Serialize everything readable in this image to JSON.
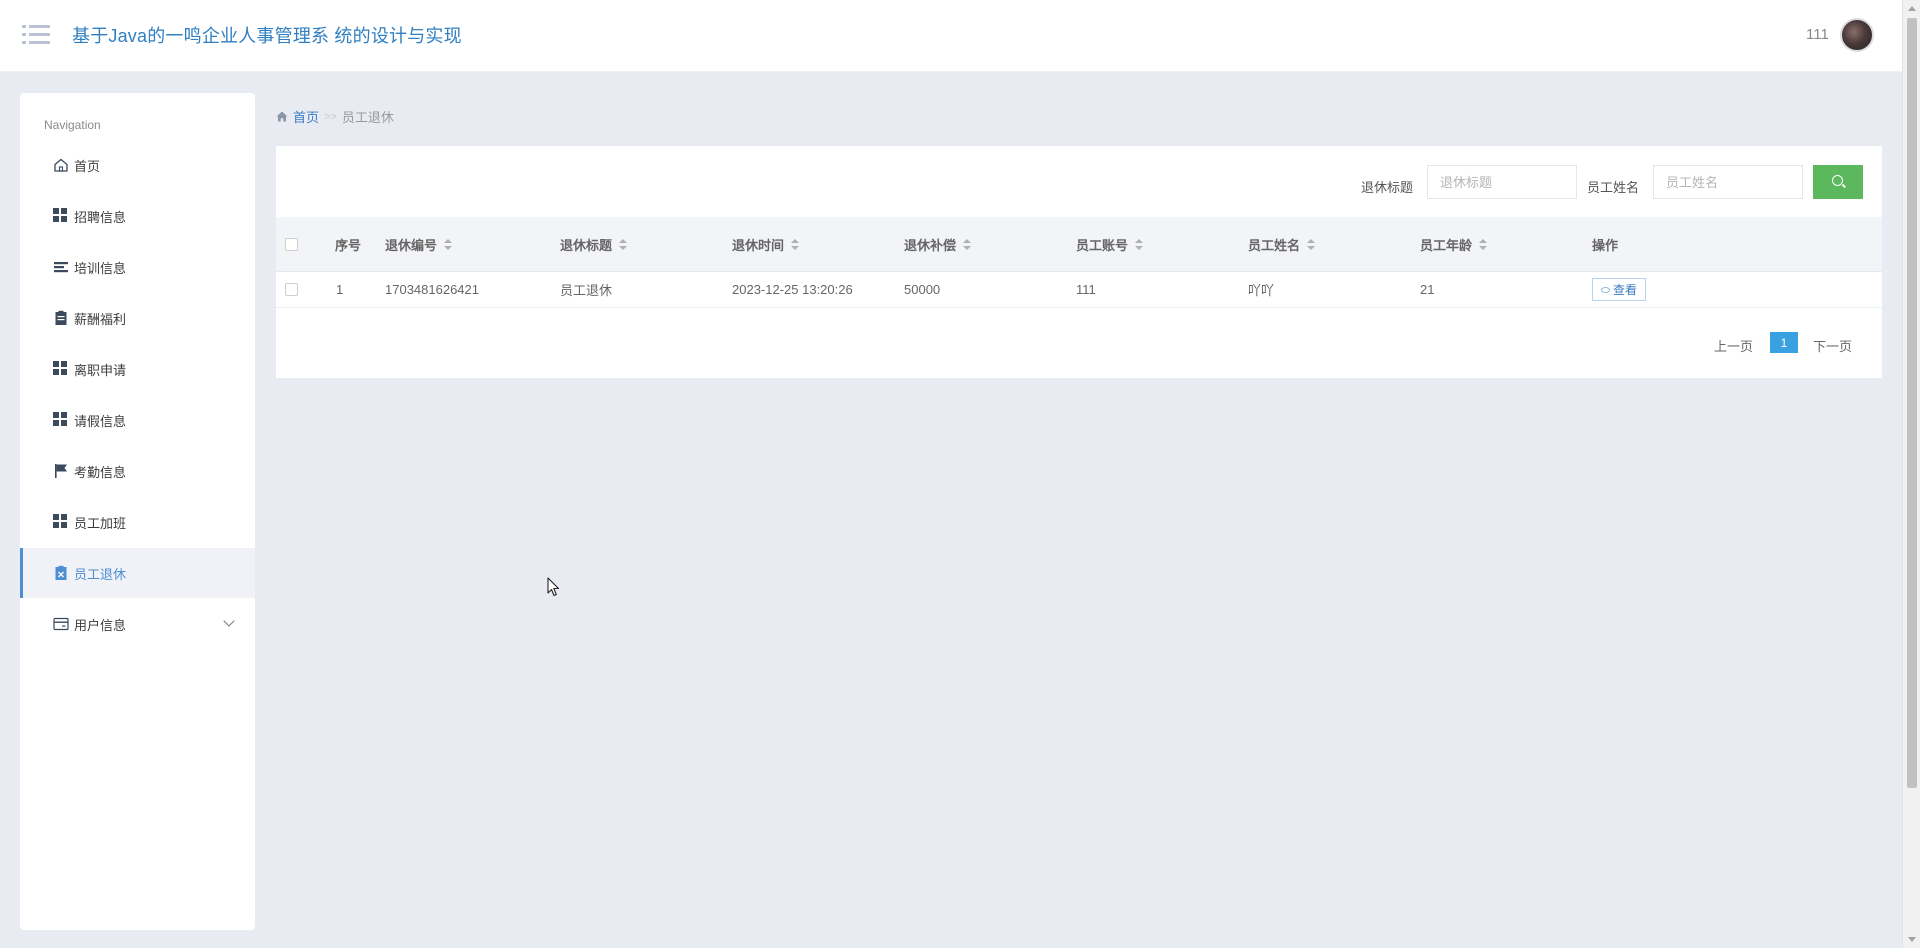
{
  "header": {
    "title": "基于Java的一鸣企业人事管理系 统的设计与实现",
    "user": "111"
  },
  "sidebar": {
    "heading": "Navigation",
    "items": [
      {
        "label": "首页",
        "icon": "home-icon"
      },
      {
        "label": "招聘信息",
        "icon": "grid-icon"
      },
      {
        "label": "培训信息",
        "icon": "list-icon"
      },
      {
        "label": "薪酬福利",
        "icon": "clipboard-icon"
      },
      {
        "label": "离职申请",
        "icon": "grid-icon"
      },
      {
        "label": "请假信息",
        "icon": "grid-icon"
      },
      {
        "label": "考勤信息",
        "icon": "flag-icon"
      },
      {
        "label": "员工加班",
        "icon": "grid-icon"
      },
      {
        "label": "员工退休",
        "icon": "clipboard-x-icon",
        "active": true
      },
      {
        "label": "用户信息",
        "icon": "card-icon",
        "expandable": true
      }
    ]
  },
  "breadcrumb": {
    "home": "首页",
    "separator": ">>",
    "current": "员工退休"
  },
  "search": {
    "title_label": "退休标题",
    "title_placeholder": "退休标题",
    "name_label": "员工姓名",
    "name_placeholder": "员工姓名"
  },
  "table": {
    "columns": [
      "序号",
      "退休编号",
      "退休标题",
      "退休时间",
      "退休补偿",
      "员工账号",
      "员工姓名",
      "员工年龄",
      "操作"
    ],
    "rows": [
      {
        "index": "1",
        "code": "1703481626421",
        "title": "员工退休",
        "time": "2023-12-25 13:20:26",
        "compensation": "50000",
        "account": "111",
        "name": "吖吖",
        "age": "21",
        "action": "查看"
      }
    ]
  },
  "pagination": {
    "prev": "上一页",
    "current": "1",
    "next": "下一页"
  },
  "colors": {
    "accent": "#3aa1e0",
    "search_button": "#5cb85c",
    "title": "#2f7fc2"
  }
}
